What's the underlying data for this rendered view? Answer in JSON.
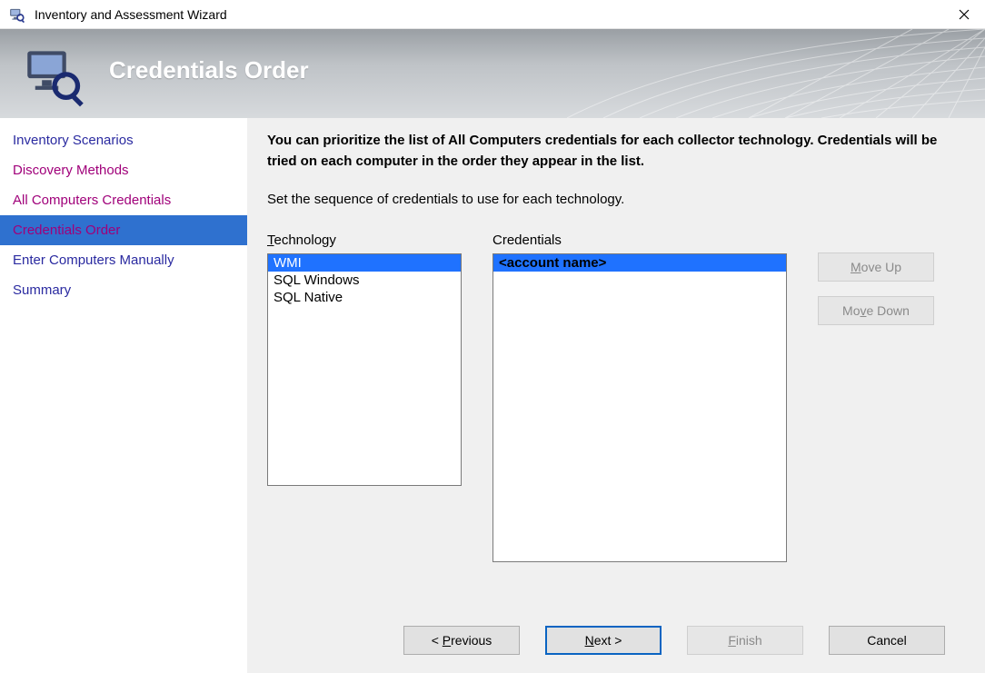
{
  "window": {
    "title": "Inventory and Assessment Wizard"
  },
  "banner": {
    "title": "Credentials Order"
  },
  "sidebar": {
    "items": [
      {
        "label": "Inventory Scenarios",
        "state": "normal"
      },
      {
        "label": "Discovery Methods",
        "state": "visited"
      },
      {
        "label": "All Computers Credentials",
        "state": "visited"
      },
      {
        "label": "Credentials Order",
        "state": "active"
      },
      {
        "label": "Enter Computers Manually",
        "state": "normal"
      },
      {
        "label": "Summary",
        "state": "normal"
      }
    ]
  },
  "content": {
    "intro": "You can prioritize the list of All Computers credentials for each collector technology. Credentials will be tried on each computer in the order they appear in the list.",
    "sub": "Set the sequence of credentials to use for each technology.",
    "tech_label_pre": "T",
    "tech_label_post": "echnology",
    "cred_label_pre": "C",
    "cred_label_post": "redentials",
    "technology": [
      {
        "label": "WMI",
        "selected": true
      },
      {
        "label": "SQL Windows",
        "selected": false
      },
      {
        "label": "SQL Native",
        "selected": false
      }
    ],
    "credentials": [
      {
        "label": "<account name>",
        "selected": true
      }
    ]
  },
  "buttons": {
    "move_up_pre": "M",
    "move_up_post": "ove Up",
    "move_down_pre": "Mo",
    "move_down_accel": "v",
    "move_down_post": "e Down",
    "previous_pre": "< ",
    "previous_accel": "P",
    "previous_post": "revious",
    "next_accel": "N",
    "next_post": "ext >",
    "finish_accel": "F",
    "finish_post": "inish",
    "cancel_pre": "C",
    "cancel_accel": "a",
    "cancel_post": "ncel"
  }
}
